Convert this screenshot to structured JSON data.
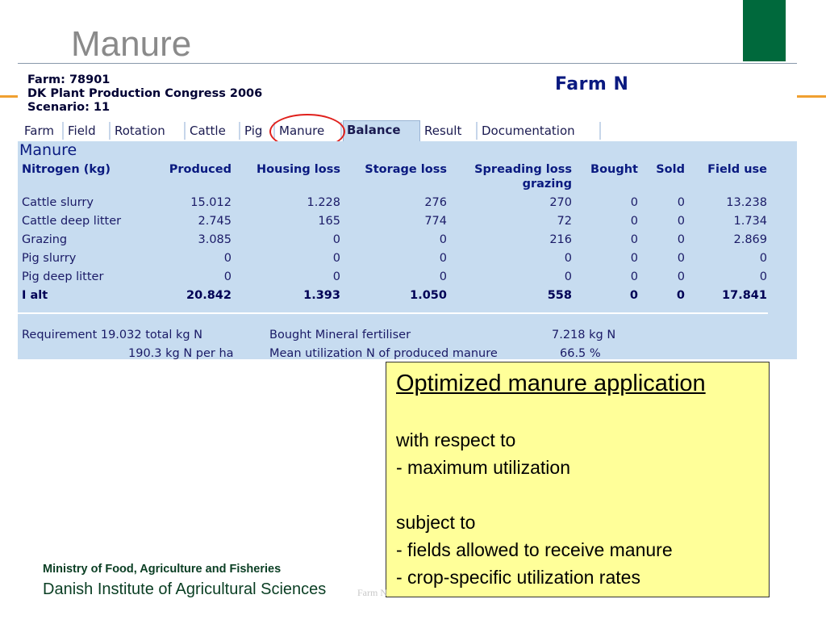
{
  "slide": {
    "title": "Manure",
    "footer_ministry": "Ministry of Food, Agriculture and Fisheries",
    "footer_institute": "Danish Institute of Agricultural Sciences",
    "footer_tag": "Farm N",
    "colors": {
      "green_bar": "#00693c",
      "orange_line": "#f0a030",
      "callout_bg": "#ffff99",
      "highlight_circle": "#e0201c"
    }
  },
  "app": {
    "farm_line": "Farm: 78901",
    "congress_line": "DK Plant Production Congress 2006",
    "scenario_line": "Scenario: 11",
    "title": "Farm N",
    "tabs": [
      {
        "label": "Farm"
      },
      {
        "label": "Field"
      },
      {
        "label": "Rotation"
      },
      {
        "label": "Cattle"
      },
      {
        "label": "Pig"
      },
      {
        "label": "Manure"
      },
      {
        "label": "Balance"
      },
      {
        "label": "Result"
      },
      {
        "label": "Documentation"
      }
    ],
    "active_tab": "Balance",
    "highlighted_tab": "Manure"
  },
  "manure": {
    "section_title": "Manure",
    "headers": [
      "Nitrogen (kg)",
      "Produced",
      "Housing loss",
      "Storage loss",
      "Spreading loss",
      "Bought",
      "Sold",
      "Field use"
    ],
    "header_sub": "grazing",
    "rows": [
      [
        "Cattle slurry",
        "15.012",
        "1.228",
        "276",
        "270",
        "0",
        "0",
        "13.238"
      ],
      [
        "Cattle deep litter",
        "2.745",
        "165",
        "774",
        "72",
        "0",
        "0",
        "1.734"
      ],
      [
        "Grazing",
        "3.085",
        "0",
        "0",
        "216",
        "0",
        "0",
        "2.869"
      ],
      [
        "Pig slurry",
        "0",
        "0",
        "0",
        "0",
        "0",
        "0",
        "0"
      ],
      [
        "Pig deep litter",
        "0",
        "0",
        "0",
        "0",
        "0",
        "0",
        "0"
      ]
    ],
    "total": [
      "I alt",
      "20.842",
      "1.393",
      "1.050",
      "558",
      "0",
      "0",
      "17.841"
    ],
    "requirement_total": "Requirement 19.032 total kg N",
    "requirement_per_ha": "190.3 kg N per ha",
    "bought_mineral_label": "Bought Mineral fertiliser",
    "bought_mineral_value": "7.218 kg N",
    "mean_util_label": "Mean utilization N of produced manure",
    "mean_util_value": "66.5 %"
  },
  "callout": {
    "title": "Optimized manure application",
    "line1": "with respect to",
    "line2": "- maximum utilization",
    "line3": "subject to",
    "line4": "- fields allowed to receive manure",
    "line5": "- crop-specific utilization rates"
  }
}
